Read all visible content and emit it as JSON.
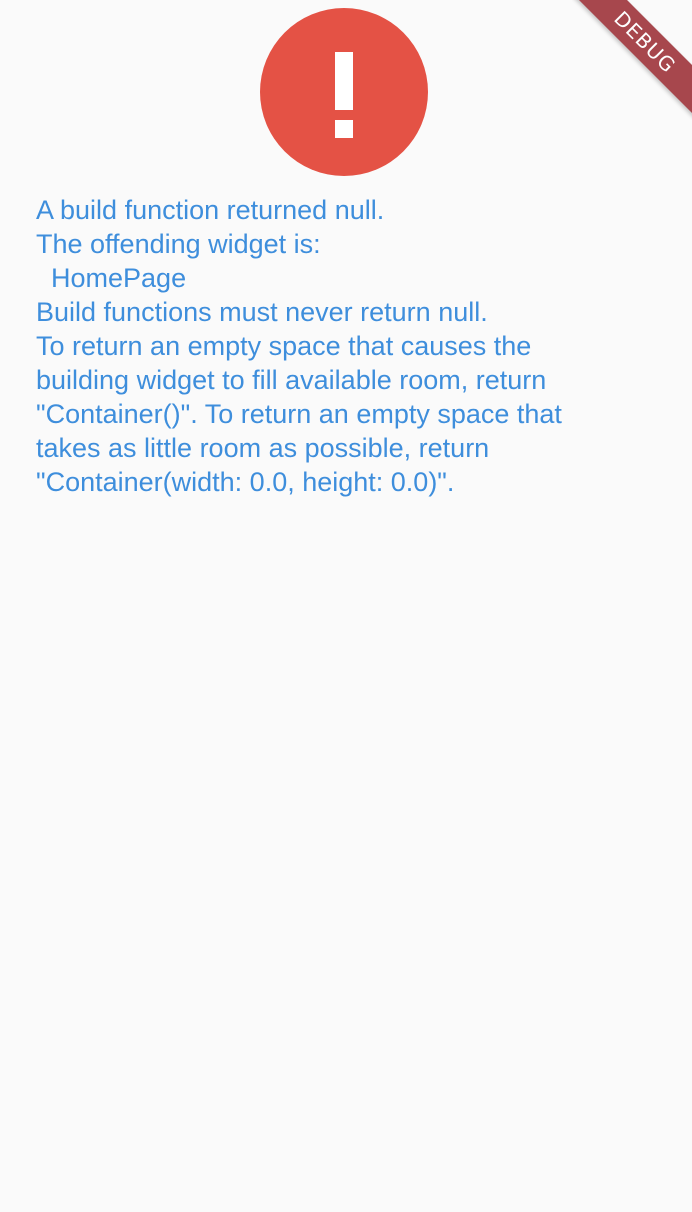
{
  "error_icon": {
    "name": "exclamation-icon",
    "color": "#e45245"
  },
  "error_message": {
    "color": "#3e8edc",
    "lines": [
      "A build function returned null.",
      "The offending widget is:",
      "  HomePage",
      "Build functions must never return null.",
      "To return an empty space that causes the",
      "building widget to fill available room, return",
      "\"Container()\". To return an empty space that",
      "takes as little room as possible, return",
      "\"Container(width: 0.0, height: 0.0)\"."
    ]
  },
  "debug_banner": {
    "label": "DEBUG",
    "color": "#a0383f"
  }
}
